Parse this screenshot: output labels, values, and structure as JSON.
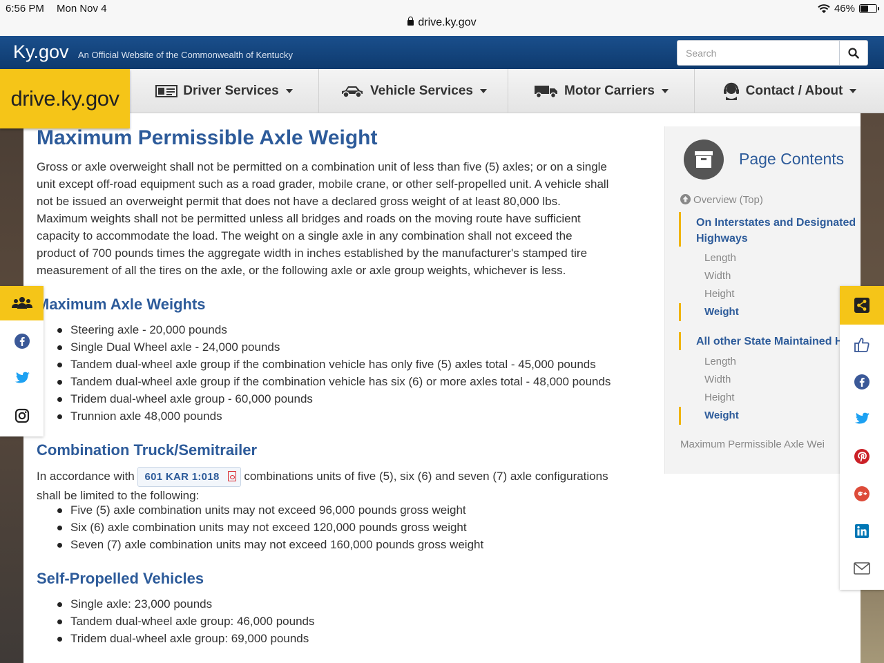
{
  "status_bar": {
    "time": "6:56 PM",
    "date": "Mon Nov 4",
    "battery": "46%",
    "battery_level": 0.46,
    "url": "drive.ky.gov"
  },
  "kygov": {
    "logo": "Ky.gov",
    "tagline": "An Official Website of the Commonwealth of Kentucky",
    "search_placeholder": "Search"
  },
  "site_logo": "drive.ky.gov",
  "nav": [
    {
      "label": "Driver Services",
      "icon": "id-card-icon"
    },
    {
      "label": "Vehicle Services",
      "icon": "car-icon"
    },
    {
      "label": "Motor Carriers",
      "icon": "truck-icon"
    },
    {
      "label": "Contact / About",
      "icon": "headset-icon"
    }
  ],
  "content": {
    "title": "Maximum Permissible Axle Weight",
    "intro_lines": [
      "Gross or axle overweight shall not be permitted on a combination unit of less than five (5) axles; or on a single",
      "unit except off-road equipment such as a road grader, mobile crane, or other self-propelled unit. A vehicle shall",
      "not be issued an overweight permit that does not have a declared gross weight of at least 80,000 lbs.",
      "Maximum weights shall not be permitted unless all bridges and roads on the moving route have sufficient",
      "capacity to accommodate the load. The weight on a single axle in any combination shall not exceed the",
      "product of 700 pounds times the aggregate width in inches established by the manufacturer's stamped tire",
      "measurement of all the tires on the axle, or the following axle or axle group weights, whichever is less."
    ],
    "axle_heading": "Maximum Axle Weights",
    "axle_items": [
      "Steering axle - 20,000 pounds",
      "Single Dual Wheel axle - 24,000 pounds",
      "Tandem dual-wheel axle group if the combination vehicle has only five (5) axles total - 45,000 pounds",
      "Tandem dual-wheel axle group if the combination vehicle has six (6) or more axles total - 48,000 pounds",
      "Tridem dual-wheel axle group - 60,000 pounds",
      "Trunnion axle 48,000 pounds"
    ],
    "combo_heading": "Combination Truck/Semitrailer",
    "combo_prefix": "In accordance with",
    "combo_link": "601 KAR 1:018",
    "combo_suffix": "combinations units of five (5), six (6) and seven (7) axle configurations",
    "combo_line2": "shall be limited to the following:",
    "combo_items": [
      "Five (5) axle combination units may not exceed 96,000 pounds gross weight",
      "Six (6) axle combination units may not exceed 120,000 pounds gross weight",
      "Seven (7) axle combination units may not exceed 160,000 pounds gross weight"
    ],
    "self_heading": "Self-Propelled Vehicles",
    "self_items": [
      "Single axle: 23,000 pounds",
      "Tandem dual-wheel axle group: 46,000 pounds",
      "Tridem dual-wheel axle group: 69,000 pounds"
    ]
  },
  "page_contents": {
    "title": "Page Contents",
    "overview": "Overview (Top)",
    "section1": [
      "On Interstates and Designated",
      "Highways"
    ],
    "section1_items": [
      "Length",
      "Width",
      "Height",
      "Weight"
    ],
    "section2": "All other State Maintained H",
    "section2_items": [
      "Length",
      "Width",
      "Height",
      "Weight"
    ],
    "bottom": "Maximum Permissible Axle Wei"
  },
  "left_social": [
    "group-icon",
    "facebook-icon",
    "twitter-icon",
    "instagram-icon"
  ],
  "right_share": [
    "share-icon",
    "like-icon",
    "facebook-icon",
    "twitter-icon",
    "pinterest-icon",
    "google-plus-icon",
    "linkedin-icon",
    "email-icon"
  ],
  "colors": {
    "brand_yellow": "#f5c518",
    "ky_blue": "#1a4f8c",
    "heading_blue": "#2d5b9a",
    "facebook": "#3b5998",
    "twitter": "#1da1f2",
    "pinterest": "#cb2027",
    "google": "#dd4b39",
    "linkedin": "#0077b5"
  }
}
